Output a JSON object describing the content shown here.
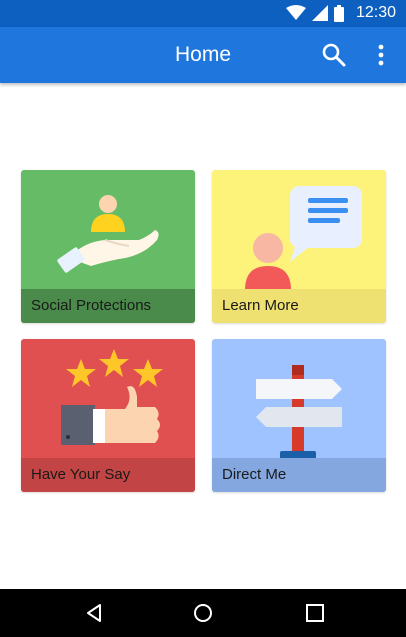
{
  "status_bar": {
    "time": "12:30",
    "icons": [
      "wifi-icon",
      "signal-icon",
      "battery-icon"
    ]
  },
  "app_bar": {
    "title": "Home",
    "actions": [
      "search-icon",
      "overflow-menu-icon"
    ]
  },
  "tiles": [
    {
      "label": "Social Protections",
      "icon": "hand-holding-person-icon",
      "color": "#66bb66"
    },
    {
      "label": "Learn More",
      "icon": "person-speech-bubble-icon",
      "color": "#fdf27a"
    },
    {
      "label": "Have Your Say",
      "icon": "thumbs-up-stars-icon",
      "color": "#e05050"
    },
    {
      "label": "Direct Me",
      "icon": "signpost-icon",
      "color": "#9ec3ff"
    }
  ],
  "nav_bar": {
    "buttons": [
      "back-icon",
      "home-icon",
      "recents-icon"
    ]
  },
  "colors": {
    "status_bar": "#0d5fc0",
    "app_bar": "#1f77dd"
  }
}
